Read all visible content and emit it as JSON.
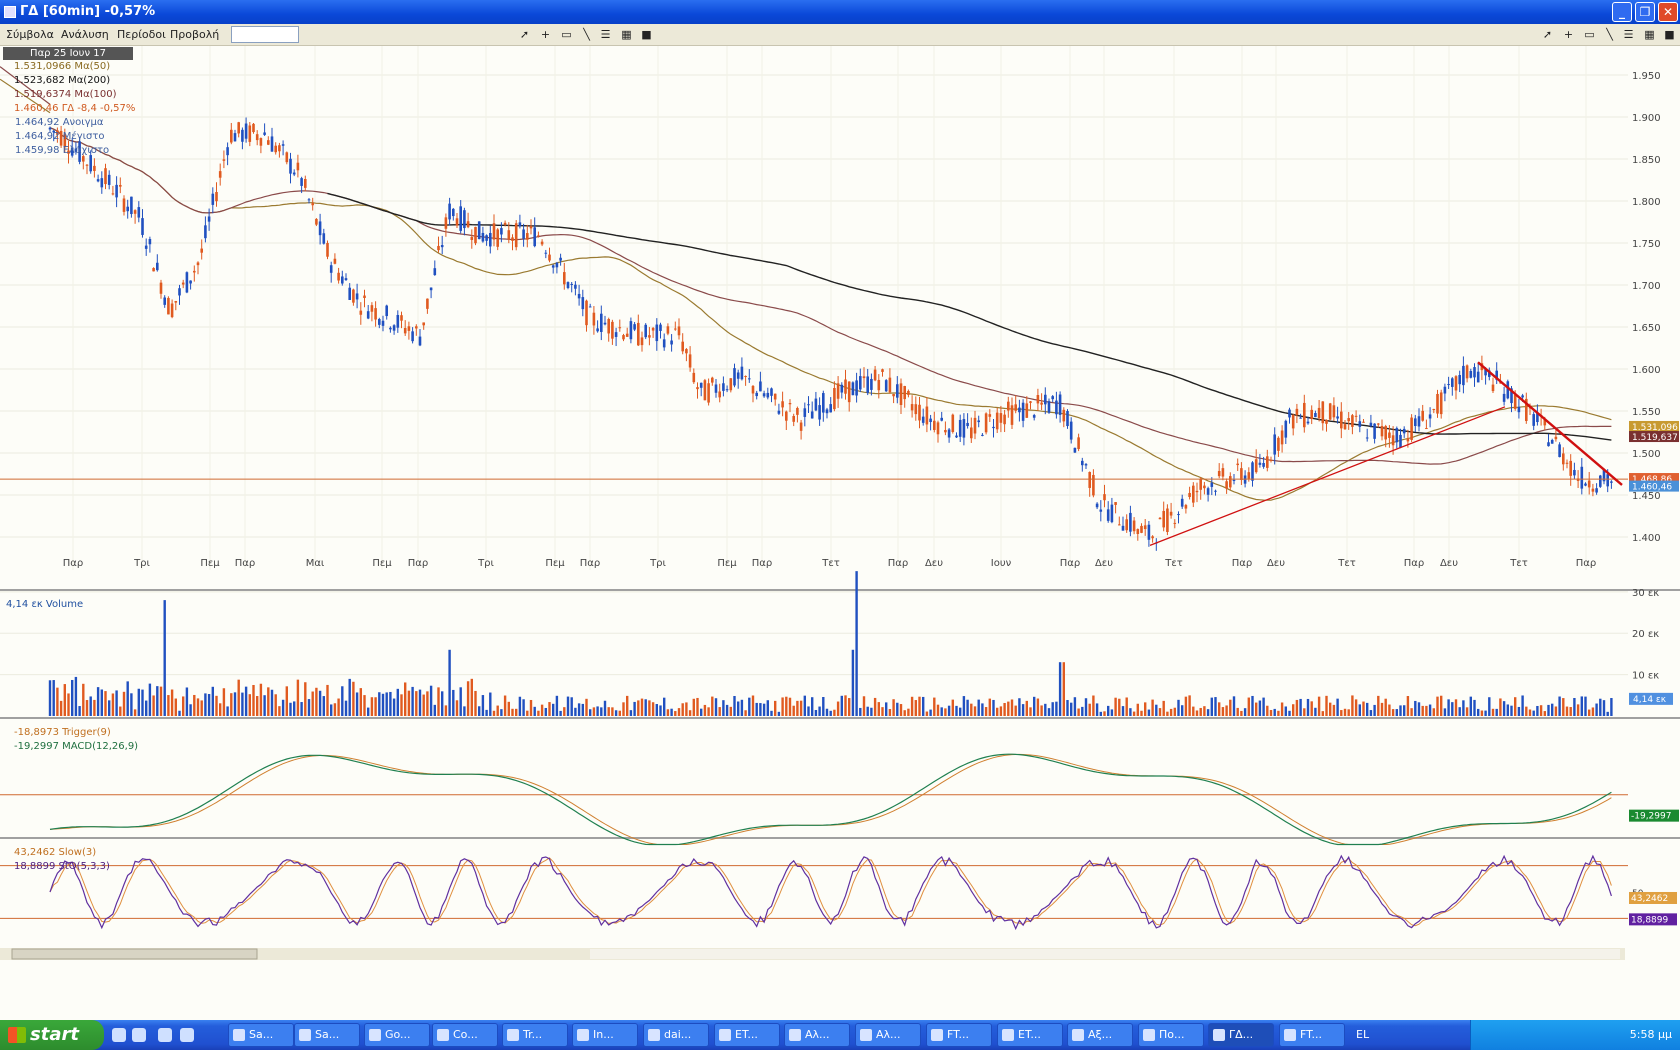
{
  "window": {
    "title": "ΓΔ [60min] -0,57%",
    "controls": [
      "_",
      "❐",
      "✕"
    ]
  },
  "menu": [
    "Σύμβολα",
    "Ανάλυση",
    "Περίοδοι",
    "Προβολή"
  ],
  "icons": {
    "toolbar": [
      "cursor-icon",
      "crosshair-icon",
      "rectangle-icon",
      "line-icon",
      "lines-icon",
      "chart-icon",
      "save-icon"
    ]
  },
  "price_panel": {
    "date_label": "Παρ 25 Ιουν 17",
    "legend": [
      {
        "text": "1.531,0966 Mα(50)",
        "color": "#8a6a20"
      },
      {
        "text": "1.523,682 Mα(200)",
        "color": "#111111"
      },
      {
        "text": "1.519,6374 Mα(100)",
        "color": "#7a3030"
      },
      {
        "text": "1.460,46 ΓΔ -8,4 -0,57%",
        "color": "#d05a20"
      },
      {
        "text": "1.464,92 Ανοιγμα",
        "color": "#4060a0"
      },
      {
        "text": "1.464,92 Μέγιστο",
        "color": "#4060a0"
      },
      {
        "text": "1.459,98 Ελάχιστο",
        "color": "#4060a0"
      }
    ],
    "y_ticks": [
      "1.950",
      "1.900",
      "1.850",
      "1.800",
      "1.750",
      "1.700",
      "1.650",
      "1.600",
      "1.550",
      "1.500",
      "1.450",
      "1.400"
    ],
    "right_labels": [
      {
        "text": "1.531,096",
        "color": "#c89a30"
      },
      {
        "text": "1.519,637",
        "color": "#7a3030"
      },
      {
        "text": "1.468,86",
        "color": "#e06030"
      },
      {
        "text": "1.460,46",
        "color": "#4a90d8"
      }
    ],
    "x_ticks": [
      "Παρ",
      "Τρι",
      "Πεμ",
      "Παρ",
      "Μαι",
      "Πεμ",
      "Παρ",
      "Τρι",
      "Πεμ",
      "Παρ",
      "Τρι",
      "Πεμ",
      "Παρ",
      "Τετ",
      "Παρ",
      "Δευ",
      "Ιουν",
      "Παρ",
      "Δευ",
      "Τετ",
      "Παρ",
      "Δευ",
      "Τετ",
      "Παρ",
      "Δευ",
      "Τετ",
      "Παρ"
    ]
  },
  "volume_panel": {
    "legend": "4,14 εκ Volume",
    "y_ticks": [
      "30 εκ",
      "20 εκ",
      "10 εκ"
    ],
    "right_label": "4,14 εκ"
  },
  "macd_panel": {
    "legend": [
      {
        "text": "-18,8973 Trigger(9)",
        "color": "#c07020"
      },
      {
        "text": "-19,2997 MACD(12,26,9)",
        "color": "#207040"
      }
    ],
    "right_label": "-19,2997"
  },
  "stoch_panel": {
    "legend": [
      {
        "text": "43,2462 Slow(3)",
        "color": "#c07020"
      },
      {
        "text": "18,8899 StO(5,3,3)",
        "color": "#502080"
      }
    ],
    "y_tick": "50",
    "right_labels": [
      {
        "text": "43,2462",
        "color": "#e0a040"
      },
      {
        "text": "18,8899",
        "color": "#6020a0"
      }
    ]
  },
  "taskbar": {
    "start_label": "start",
    "tasks": [
      "Sa...",
      "Sa...",
      "Go...",
      "Co...",
      "Tr...",
      "In...",
      "dai...",
      "ET...",
      "Αλ...",
      "Αλ...",
      "FT...",
      "ET...",
      "Αξ...",
      "Πο...",
      "ΓΔ...",
      "FT..."
    ],
    "language": "EL",
    "clock": "5:58 μμ"
  },
  "colors": {
    "up_candle": "#2050c0",
    "down_candle": "#e05a20",
    "ma50": "#9a7a30",
    "ma100": "#8a4a4a",
    "ma200": "#222222",
    "trendline": "#d01010"
  }
}
